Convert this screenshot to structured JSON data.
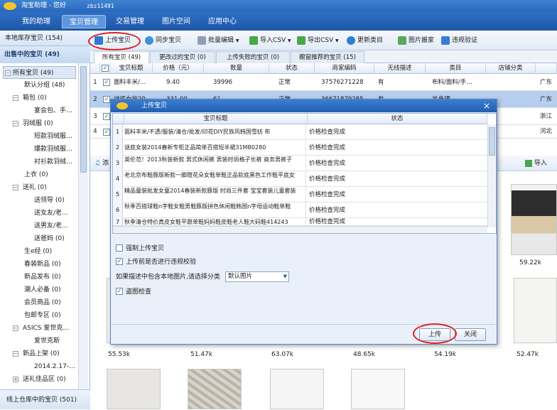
{
  "app": {
    "title": "淘宝助理 - 您好",
    "user": "zbz11491"
  },
  "menu": [
    {
      "label": "我的助理"
    },
    {
      "label": "宝贝管理"
    },
    {
      "label": "交易管理"
    },
    {
      "label": "图片空间"
    },
    {
      "label": "应用中心"
    }
  ],
  "sidebar": {
    "local_store": "本地库存宝贝 (154)",
    "on_sale": "出售中的宝贝 (49)",
    "tree": [
      {
        "label": "所有宝贝 (49)"
      },
      {
        "label": "默认分组 (48)"
      },
      {
        "label": "箱包 (0)"
      },
      {
        "label": "宴会包、手…"
      },
      {
        "label": "羽绒服 (0)"
      },
      {
        "label": "短款羽绒服…"
      },
      {
        "label": "爆款羽绒服…"
      },
      {
        "label": "衬衫款羽绒…"
      },
      {
        "label": "上衣 (0)"
      },
      {
        "label": "送礼 (0)"
      },
      {
        "label": "送领导 (0)"
      },
      {
        "label": "送女友/老…"
      },
      {
        "label": "送男友/老…"
      },
      {
        "label": "送爸妈 (0)"
      },
      {
        "label": "生e经 (0)"
      },
      {
        "label": "春装新品 (0)"
      },
      {
        "label": "新品发布 (0)"
      },
      {
        "label": "潮人必备 (0)"
      },
      {
        "label": "会员商品 (0)"
      },
      {
        "label": "包邮专区 (0)"
      },
      {
        "label": "ASICS 爱世克…"
      },
      {
        "label": "爱世克斯"
      },
      {
        "label": "新品上架 (0)"
      },
      {
        "label": "2014.2.17-…"
      },
      {
        "label": "送礼佳品区 (0)"
      }
    ],
    "warehouse": "线上仓库中的宝贝 (501)"
  },
  "toolbar": {
    "upload": "上传宝贝",
    "sync": "同步宝贝",
    "batch_edit": "批量编辑",
    "import_csv": "导入CSV",
    "export_csv": "导出CSV",
    "update_category": "更新类目",
    "image_mover": "图片搬家",
    "violation_check": "违规验证"
  },
  "tabs": [
    {
      "label": "所有宝贝 (49)"
    },
    {
      "label": "更改过的宝贝 (0)"
    },
    {
      "label": "上传失败的宝贝 (0)"
    },
    {
      "label": "橱窗推荐的宝贝 (15)"
    }
  ],
  "grid": {
    "headers": [
      "宝贝标题",
      "价格（元）",
      "数量",
      "状态",
      "商家编码",
      "无线描述",
      "类目",
      "店铺分类"
    ],
    "rows": [
      {
        "num": "1",
        "title": "面料丰米/…",
        "price": "9.40",
        "qty": "39996",
        "status": "正常",
        "code": "37576271228",
        "wireless": "有",
        "category": "布料/面料/手…",
        "extra": "广东"
      },
      {
        "num": "2",
        "title": "谜底女装20…",
        "price": "331.00",
        "qty": "61",
        "status": "正常",
        "code": "36671879285",
        "wireless": "有",
        "category": "半身裙",
        "extra": "广东"
      },
      {
        "num": "3",
        "extra": "浙江"
      },
      {
        "num": "4",
        "extra": "河北"
      }
    ]
  },
  "lower_bar": {
    "add": "添",
    "import": "导入"
  },
  "image_sizes": [
    "59.22k",
    "55.53k",
    "51.47k",
    "63.07k",
    "48.65k",
    "54.19k",
    "52.47k"
  ],
  "dialog": {
    "title": "上传宝贝",
    "col_title": "宝贝标题",
    "col_status": "状态",
    "rows": [
      {
        "num": "1",
        "title": "面料丰米/不透/服装/清仓/批发/印花DIY民族风韩国雪纺 布",
        "status": "价格检查完成"
      },
      {
        "num": "2",
        "title": "谜底女装2014春新专柜正品简单百搭短半裙31MB0280",
        "status": "价格检查完成"
      },
      {
        "num": "3",
        "title": "英伦范！2013秋装新款 男式休闲裤 男装时尚格子长裤 商务男裤子",
        "status": "价格检查完成"
      },
      {
        "num": "4",
        "title": "老北京布鞋豚版新款一脚蹬花朵女鞋单鞋正品软底黑色工作鞋平底女",
        "status": "价格检查完成"
      },
      {
        "num": "5",
        "title": "精品童装批发女童2014春装新款豚版 时尚三件套 宝宝套装儿童套装",
        "status": "价格检查完成"
      },
      {
        "num": "6",
        "title": "秋季百搭球鞋n字鞋女鞋男鞋豚版拼色休闲鞋韩国n字母运动鞋单鞋",
        "status": "价格检查完成"
      },
      {
        "num": "7",
        "title": "秋季清仓特价真皮女鞋平跟单鞋妈妈鞋皮鞋老人鞋大码鞋414243",
        "status": "价格检查完成"
      }
    ],
    "force_upload": "强制上传宝贝",
    "pre_check": "上传前是否进行违规校验",
    "local_images_prompt": "如果描述中包含本地图片,请选择分类",
    "image_category": "默认图片",
    "theft_check": "盗图检查",
    "upload_btn": "上传",
    "close_btn": "关闭",
    "colors": {
      "accent": "#2a68bd",
      "highlight_oval": "#e02020"
    }
  }
}
